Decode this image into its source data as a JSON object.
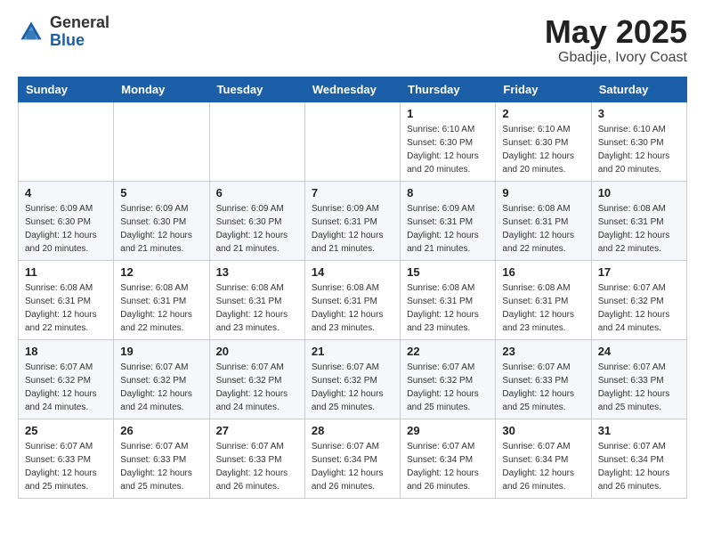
{
  "header": {
    "logo_general": "General",
    "logo_blue": "Blue",
    "month_title": "May 2025",
    "location": "Gbadjie, Ivory Coast"
  },
  "days_of_week": [
    "Sunday",
    "Monday",
    "Tuesday",
    "Wednesday",
    "Thursday",
    "Friday",
    "Saturday"
  ],
  "weeks": [
    [
      {
        "day": "",
        "info": ""
      },
      {
        "day": "",
        "info": ""
      },
      {
        "day": "",
        "info": ""
      },
      {
        "day": "",
        "info": ""
      },
      {
        "day": "1",
        "info": "Sunrise: 6:10 AM\nSunset: 6:30 PM\nDaylight: 12 hours\nand 20 minutes."
      },
      {
        "day": "2",
        "info": "Sunrise: 6:10 AM\nSunset: 6:30 PM\nDaylight: 12 hours\nand 20 minutes."
      },
      {
        "day": "3",
        "info": "Sunrise: 6:10 AM\nSunset: 6:30 PM\nDaylight: 12 hours\nand 20 minutes."
      }
    ],
    [
      {
        "day": "4",
        "info": "Sunrise: 6:09 AM\nSunset: 6:30 PM\nDaylight: 12 hours\nand 20 minutes."
      },
      {
        "day": "5",
        "info": "Sunrise: 6:09 AM\nSunset: 6:30 PM\nDaylight: 12 hours\nand 21 minutes."
      },
      {
        "day": "6",
        "info": "Sunrise: 6:09 AM\nSunset: 6:30 PM\nDaylight: 12 hours\nand 21 minutes."
      },
      {
        "day": "7",
        "info": "Sunrise: 6:09 AM\nSunset: 6:31 PM\nDaylight: 12 hours\nand 21 minutes."
      },
      {
        "day": "8",
        "info": "Sunrise: 6:09 AM\nSunset: 6:31 PM\nDaylight: 12 hours\nand 21 minutes."
      },
      {
        "day": "9",
        "info": "Sunrise: 6:08 AM\nSunset: 6:31 PM\nDaylight: 12 hours\nand 22 minutes."
      },
      {
        "day": "10",
        "info": "Sunrise: 6:08 AM\nSunset: 6:31 PM\nDaylight: 12 hours\nand 22 minutes."
      }
    ],
    [
      {
        "day": "11",
        "info": "Sunrise: 6:08 AM\nSunset: 6:31 PM\nDaylight: 12 hours\nand 22 minutes."
      },
      {
        "day": "12",
        "info": "Sunrise: 6:08 AM\nSunset: 6:31 PM\nDaylight: 12 hours\nand 22 minutes."
      },
      {
        "day": "13",
        "info": "Sunrise: 6:08 AM\nSunset: 6:31 PM\nDaylight: 12 hours\nand 23 minutes."
      },
      {
        "day": "14",
        "info": "Sunrise: 6:08 AM\nSunset: 6:31 PM\nDaylight: 12 hours\nand 23 minutes."
      },
      {
        "day": "15",
        "info": "Sunrise: 6:08 AM\nSunset: 6:31 PM\nDaylight: 12 hours\nand 23 minutes."
      },
      {
        "day": "16",
        "info": "Sunrise: 6:08 AM\nSunset: 6:31 PM\nDaylight: 12 hours\nand 23 minutes."
      },
      {
        "day": "17",
        "info": "Sunrise: 6:07 AM\nSunset: 6:32 PM\nDaylight: 12 hours\nand 24 minutes."
      }
    ],
    [
      {
        "day": "18",
        "info": "Sunrise: 6:07 AM\nSunset: 6:32 PM\nDaylight: 12 hours\nand 24 minutes."
      },
      {
        "day": "19",
        "info": "Sunrise: 6:07 AM\nSunset: 6:32 PM\nDaylight: 12 hours\nand 24 minutes."
      },
      {
        "day": "20",
        "info": "Sunrise: 6:07 AM\nSunset: 6:32 PM\nDaylight: 12 hours\nand 24 minutes."
      },
      {
        "day": "21",
        "info": "Sunrise: 6:07 AM\nSunset: 6:32 PM\nDaylight: 12 hours\nand 25 minutes."
      },
      {
        "day": "22",
        "info": "Sunrise: 6:07 AM\nSunset: 6:32 PM\nDaylight: 12 hours\nand 25 minutes."
      },
      {
        "day": "23",
        "info": "Sunrise: 6:07 AM\nSunset: 6:33 PM\nDaylight: 12 hours\nand 25 minutes."
      },
      {
        "day": "24",
        "info": "Sunrise: 6:07 AM\nSunset: 6:33 PM\nDaylight: 12 hours\nand 25 minutes."
      }
    ],
    [
      {
        "day": "25",
        "info": "Sunrise: 6:07 AM\nSunset: 6:33 PM\nDaylight: 12 hours\nand 25 minutes."
      },
      {
        "day": "26",
        "info": "Sunrise: 6:07 AM\nSunset: 6:33 PM\nDaylight: 12 hours\nand 25 minutes."
      },
      {
        "day": "27",
        "info": "Sunrise: 6:07 AM\nSunset: 6:33 PM\nDaylight: 12 hours\nand 26 minutes."
      },
      {
        "day": "28",
        "info": "Sunrise: 6:07 AM\nSunset: 6:34 PM\nDaylight: 12 hours\nand 26 minutes."
      },
      {
        "day": "29",
        "info": "Sunrise: 6:07 AM\nSunset: 6:34 PM\nDaylight: 12 hours\nand 26 minutes."
      },
      {
        "day": "30",
        "info": "Sunrise: 6:07 AM\nSunset: 6:34 PM\nDaylight: 12 hours\nand 26 minutes."
      },
      {
        "day": "31",
        "info": "Sunrise: 6:07 AM\nSunset: 6:34 PM\nDaylight: 12 hours\nand 26 minutes."
      }
    ]
  ]
}
